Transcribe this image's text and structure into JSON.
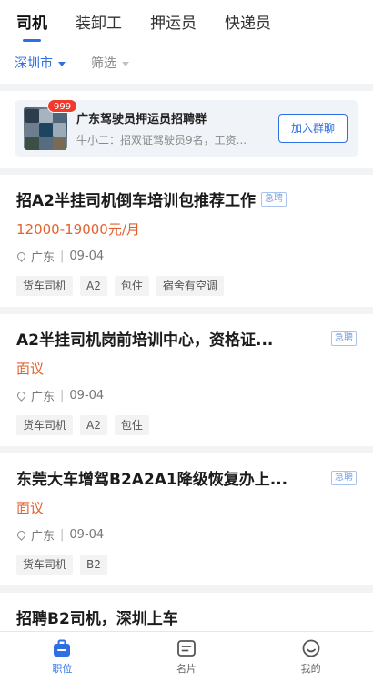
{
  "tabs": [
    {
      "label": "司机",
      "active": true
    },
    {
      "label": "装卸工",
      "active": false
    },
    {
      "label": "押运员",
      "active": false
    },
    {
      "label": "快递员",
      "active": false
    }
  ],
  "filters": {
    "city": "深圳市",
    "screen": "筛选"
  },
  "group": {
    "badge": "999",
    "title": "广东驾驶员押运员招聘群",
    "subtitle": "牛小二：招双证驾驶员9名，工资...",
    "join_label": "加入群聊"
  },
  "jobs": [
    {
      "title": "招A2半挂司机倒车培训包推荐工作",
      "urgent": "急聘",
      "salary": "12000-19000元/月",
      "location": "广东",
      "date": "09-04",
      "tags": [
        "货车司机",
        "A2",
        "包住",
        "宿舍有空调"
      ]
    },
    {
      "title": "A2半挂司机岗前培训中心，资格证...",
      "urgent": "急聘",
      "salary": "面议",
      "location": "广东",
      "date": "09-04",
      "tags": [
        "货车司机",
        "A2",
        "包住"
      ]
    },
    {
      "title": "东莞大车增驾B2A2A1降级恢复办上...",
      "urgent": "急聘",
      "salary": "面议",
      "location": "广东",
      "date": "09-04",
      "tags": [
        "货车司机",
        "B2"
      ]
    },
    {
      "title": "招聘B2司机，深圳上车"
    }
  ],
  "bottom_nav": [
    {
      "label": "职位",
      "icon": "briefcase-icon",
      "active": true
    },
    {
      "label": "名片",
      "icon": "card-icon",
      "active": false
    },
    {
      "label": "我的",
      "icon": "smile-icon",
      "active": false
    }
  ],
  "colors": {
    "accent": "#2f6fe4",
    "salary": "#e2622f",
    "badge": "#ee3b2e"
  }
}
